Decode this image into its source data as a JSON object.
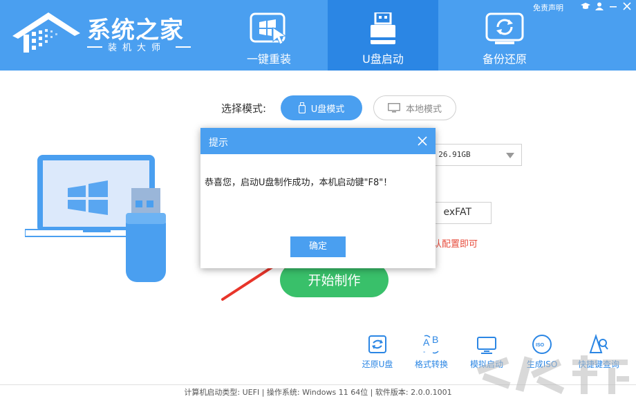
{
  "header": {
    "brand_title": "系统之家",
    "brand_subtitle": "装机大师",
    "top_links": {
      "disclaimer": "免责声明"
    },
    "top_icons": [
      "graduation-cap-icon",
      "user-icon",
      "minimize-icon",
      "close-icon"
    ],
    "tabs": [
      {
        "label": "一键重装",
        "icon": "windows-cursor-icon",
        "active": false
      },
      {
        "label": "U盘启动",
        "icon": "usb-drive-icon",
        "active": true
      },
      {
        "label": "备份还原",
        "icon": "backup-restore-icon",
        "active": false
      }
    ]
  },
  "main": {
    "mode_label": "选择模式:",
    "mode_usb": "U盘模式",
    "mode_local": "本地模式",
    "device_value": ") 26.91GB",
    "filesystem_value": "exFAT",
    "hint_text": "认配置即可",
    "start_button": "开始制作"
  },
  "tools": [
    {
      "label": "还原U盘",
      "icon": "restore-usb-icon"
    },
    {
      "label": "格式转换",
      "icon": "format-convert-icon"
    },
    {
      "label": "模拟启动",
      "icon": "simulate-boot-icon"
    },
    {
      "label": "生成ISO",
      "icon": "iso-disc-icon"
    },
    {
      "label": "快捷键查询",
      "icon": "shortcut-search-icon"
    }
  ],
  "status_bar": {
    "text": "计算机启动类型: UEFI | 操作系统: Windows 11 64位 | 软件版本: 2.0.0.1001"
  },
  "dialog": {
    "title": "提示",
    "message": "恭喜您，启动U盘制作成功，本机启动键\"F8\"！",
    "ok_button": "确定"
  },
  "colors": {
    "brand_blue": "#4a9ff0",
    "active_tab_blue": "#2b86e4",
    "start_green": "#39c06a",
    "hint_red": "#e74c3c",
    "annotation_arrow": "#e8352a"
  }
}
